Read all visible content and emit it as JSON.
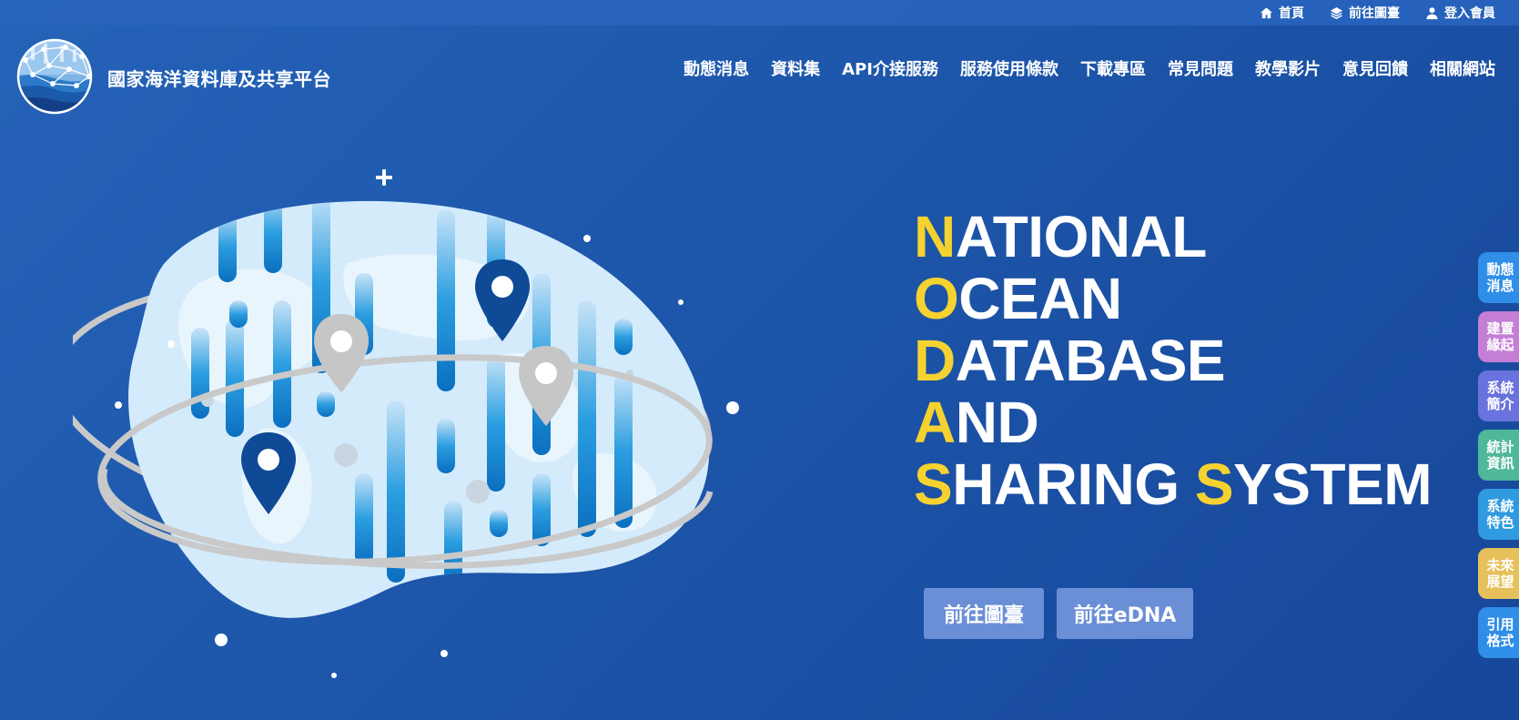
{
  "topbar": {
    "home": "首頁",
    "map": "前往圖臺",
    "login": "登入會員"
  },
  "logo": {
    "title": "國家海洋資料庫及共享平台"
  },
  "nav": [
    {
      "label": "動態消息"
    },
    {
      "label": "資料集"
    },
    {
      "label": "API介接服務"
    },
    {
      "label": "服務使用條款"
    },
    {
      "label": "下載專區"
    },
    {
      "label": "常見問題"
    },
    {
      "label": "教學影片"
    },
    {
      "label": "意見回饋"
    },
    {
      "label": "相關網站"
    }
  ],
  "headline": [
    {
      "initial": "N",
      "rest": "ATIONAL"
    },
    {
      "initial": "O",
      "rest": "CEAN"
    },
    {
      "initial": "D",
      "rest": "ATABASE"
    },
    {
      "initial": "A",
      "rest": "ND"
    },
    {
      "initial": "S",
      "rest": "HARING ",
      "initial2": "S",
      "rest2": "YSTEM"
    }
  ],
  "cta": {
    "map": "前往圖臺",
    "edna": "前往eDNA"
  },
  "side_tabs": [
    {
      "line1": "動態",
      "line2": "消息",
      "color": "#2f8ee8"
    },
    {
      "line1": "建置",
      "line2": "緣起",
      "color": "#c57ed6"
    },
    {
      "line1": "系統",
      "line2": "簡介",
      "color": "#6a72dd"
    },
    {
      "line1": "統計",
      "line2": "資訊",
      "color": "#4fb89a"
    },
    {
      "line1": "系統",
      "line2": "特色",
      "color": "#2f9adf"
    },
    {
      "line1": "未來",
      "line2": "展望",
      "color": "#e6c15b"
    },
    {
      "line1": "引用",
      "line2": "格式",
      "color": "#2f8ee8"
    }
  ],
  "colors": {
    "accent": "#f5d22f",
    "background": "#1d56aa",
    "button": "#6b8fd6"
  }
}
